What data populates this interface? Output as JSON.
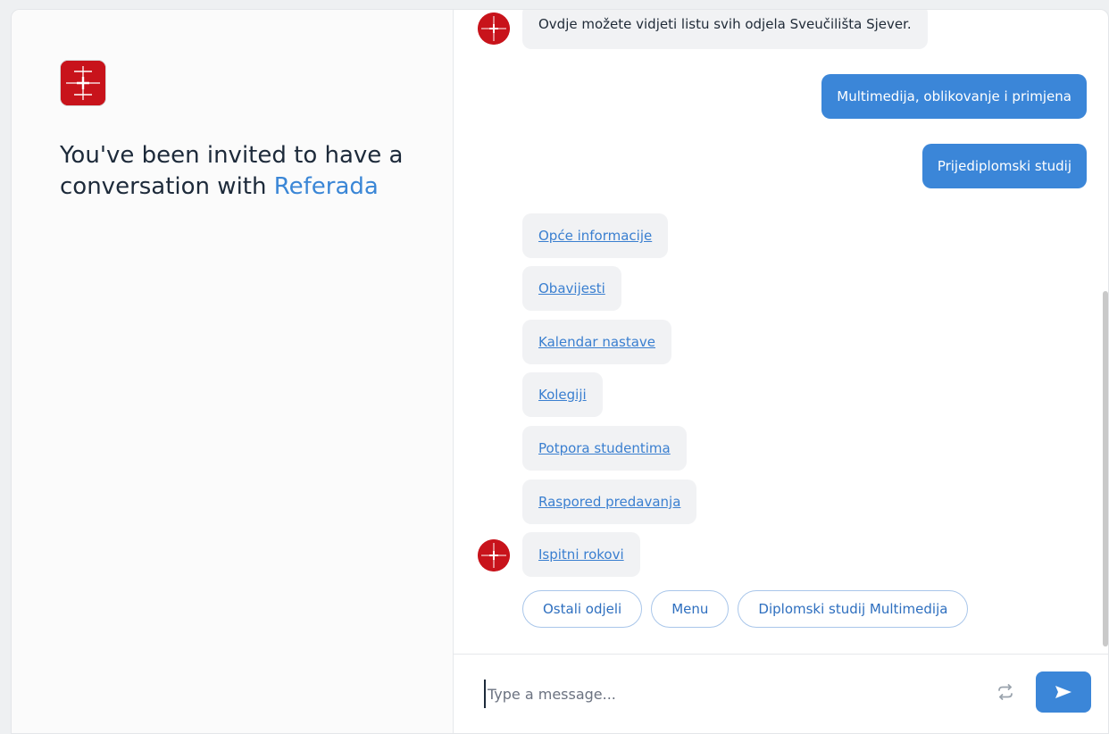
{
  "sidebar": {
    "invite_prefix": "You've been invited to have a conversation with ",
    "bot_name": "Referada"
  },
  "chat": {
    "messages": [
      {
        "from": "bot",
        "text": "Ovdje možete vidjeti listu svih odjela Sveučilišta Sjever."
      },
      {
        "from": "user",
        "text": "Multimedija, oblikovanje i primjena"
      },
      {
        "from": "user",
        "text": "Prijediplomski studij"
      }
    ],
    "links": [
      "Opće informacije",
      "Obavijesti",
      "Kalendar nastave",
      "Kolegiji",
      "Potpora studentima",
      "Raspored predavanja",
      "Ispitni rokovi"
    ],
    "quick_replies": [
      "Ostali odjeli",
      "Menu",
      "Diplomski studij Multimedija"
    ]
  },
  "composer": {
    "placeholder": "Type a message..."
  },
  "colors": {
    "accent": "#3b86d8",
    "brand_red": "#c8131b",
    "bot_bubble": "#f1f2f4"
  },
  "icons": {
    "refresh": "refresh-icon",
    "send": "send-icon"
  }
}
